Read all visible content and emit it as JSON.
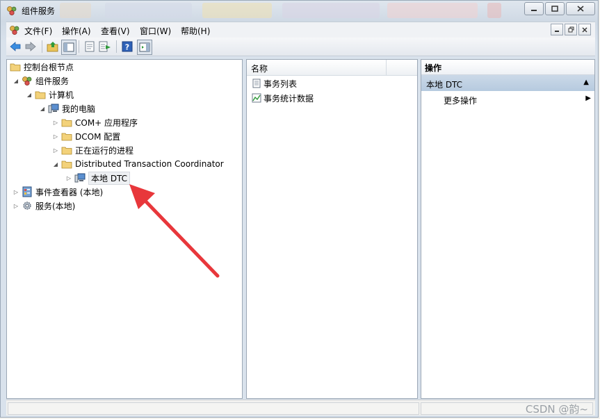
{
  "window": {
    "title": "组件服务"
  },
  "menu": {
    "items": [
      "文件(F)",
      "操作(A)",
      "查看(V)",
      "窗口(W)",
      "帮助(H)"
    ]
  },
  "toolbar": {
    "icons": [
      "back-arrow-icon",
      "forward-arrow-icon",
      "up-folder-icon",
      "show-hide-tree-icon",
      "properties-icon",
      "export-list-icon",
      "help-icon",
      "show-hide-action-pane-icon"
    ]
  },
  "tree": {
    "root": "控制台根节点",
    "component_services": "组件服务",
    "computers": "计算机",
    "my_computer": "我的电脑",
    "com_apps": "COM+ 应用程序",
    "dcom": "DCOM 配置",
    "running": "正在运行的进程",
    "dtc": "Distributed Transaction Coordinator",
    "local_dtc": "本地 DTC",
    "event_viewer": "事件查看器 (本地)",
    "services": "服务(本地)"
  },
  "center": {
    "column_header": "名称",
    "items": [
      "事务列表",
      "事务统计数据"
    ]
  },
  "actions": {
    "header": "操作",
    "section": "本地 DTC",
    "more": "更多操作"
  },
  "watermark": "CSDN @韵~",
  "colors": {
    "annotation_arrow": "#e8373b",
    "action_section": "#c2d4e6"
  }
}
